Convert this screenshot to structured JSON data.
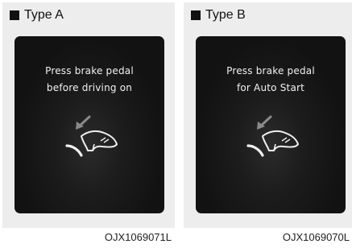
{
  "panels": [
    {
      "type_label": "Type A",
      "message_line1": "Press brake pedal",
      "message_line2": "before driving on",
      "code": "OJX1069071L"
    },
    {
      "type_label": "Type B",
      "message_line1": "Press brake pedal",
      "message_line2": "for Auto Start",
      "code": "OJX1069070L"
    }
  ],
  "colors": {
    "screen_background": "#161616",
    "message_text": "#f2f2f2",
    "panel_background": "#ededee",
    "arrow": "#8a8a8a"
  },
  "icons": [
    "brake-pedal-press-icon"
  ]
}
